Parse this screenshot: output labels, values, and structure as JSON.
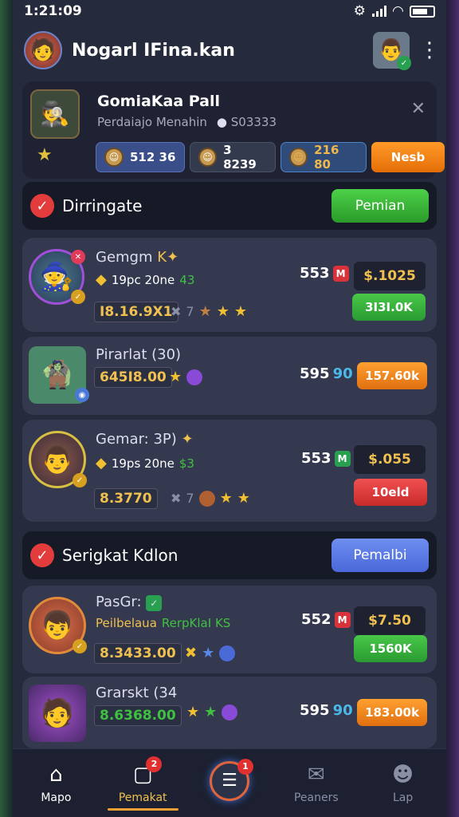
{
  "status": {
    "time": "1:21:09"
  },
  "header": {
    "title": "Nogarl IFina.kan"
  },
  "profile": {
    "title": "GomiaKaa Pall",
    "subtitle": "Perdaiajo Menahin",
    "subtitle_value": "S03333",
    "chips": [
      "512 36",
      "3 8239",
      "216 80"
    ],
    "action": "Nesb"
  },
  "section1": {
    "title": "Dirringate",
    "button": "Pemian"
  },
  "section2": {
    "title": "Serigkat Kdlon",
    "button": "Pemalbi"
  },
  "rows": [
    {
      "name": "Gemgm ",
      "name_mark": "K",
      "line": "19pc 20ne",
      "line_tag": "43",
      "code": "I8.16.9X1",
      "count": "7",
      "score": "553",
      "score_badge": "M",
      "price": "$.1025",
      "pill": "3I3I.0K"
    },
    {
      "name": "Pirarlat (30)",
      "code": "645I8.00",
      "score": "595",
      "score_badge": "90",
      "pill": "157.60k"
    },
    {
      "name": "Gemar: 3P)",
      "line": "19ps 20ne",
      "line_tag": "$3",
      "code": "8.3770",
      "count": "7",
      "score": "553",
      "score_badge": "M",
      "price": "$.055",
      "pill": "10eld"
    },
    {
      "name": "PasGr:",
      "line": "Peilbelaua",
      "line_tag": "RerpKlaI KS",
      "code": "8.3433.00",
      "score": "552",
      "score_badge": "M",
      "price": "$7.50",
      "pill": "1560K"
    },
    {
      "name": "Grarskt (34",
      "code": "8.6368.00",
      "score": "595",
      "score_badge": "90",
      "pill": "183.00k"
    }
  ],
  "nav": {
    "items": [
      {
        "label": "Mapo"
      },
      {
        "label": "Pemakat",
        "badge": "2"
      },
      {
        "label": "",
        "badge": "1"
      },
      {
        "label": "Peaners"
      },
      {
        "label": "Lap"
      }
    ]
  },
  "colors": {
    "bg": "#252a3c",
    "accent_orange": "#f0a030",
    "green": "#3ab83a",
    "blue": "#5a78e0"
  }
}
